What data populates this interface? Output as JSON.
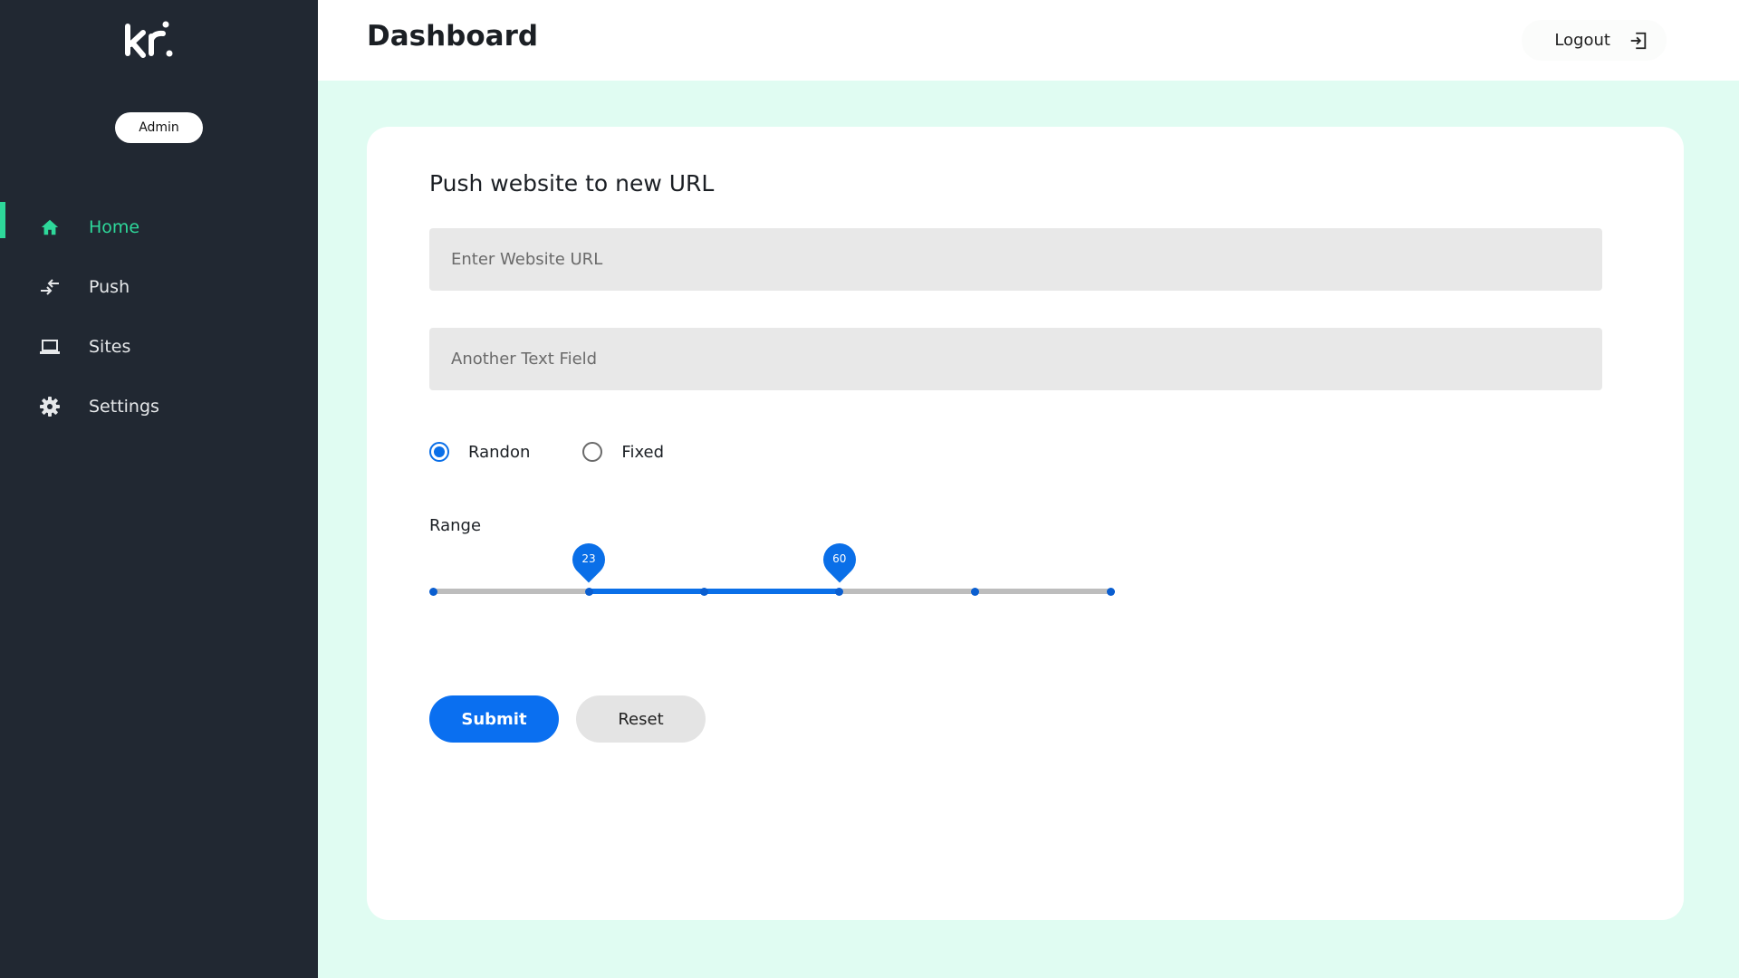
{
  "sidebar": {
    "logo_text": "kr.",
    "role_badge": "Admin",
    "items": [
      {
        "label": "Home",
        "icon": "home-icon",
        "active": true
      },
      {
        "label": "Push",
        "icon": "push-arrows-icon",
        "active": false
      },
      {
        "label": "Sites",
        "icon": "laptop-icon",
        "active": false
      },
      {
        "label": "Settings",
        "icon": "gear-icon",
        "active": false
      }
    ],
    "active_color": "#2ed89a",
    "background": "#212832"
  },
  "header": {
    "title": "Dashboard",
    "logout_label": "Logout",
    "logout_icon": "logout-icon"
  },
  "form": {
    "title": "Push website to new URL",
    "url_field": {
      "placeholder": "Enter Website URL",
      "value": ""
    },
    "other_field": {
      "placeholder": "Another Text Field",
      "value": ""
    },
    "radio_options": [
      {
        "label": "Randon",
        "checked": true
      },
      {
        "label": "Fixed",
        "checked": false
      }
    ],
    "range_label": "Range",
    "range": {
      "min": 0,
      "max": 100,
      "low": 23,
      "high": 60,
      "low_label": "23",
      "high_label": "60",
      "marks": [
        0,
        23,
        40,
        60,
        80,
        100
      ]
    },
    "submit_label": "Submit",
    "reset_label": "Reset"
  },
  "colors": {
    "accent": "#0a6ff0",
    "page_background": "#e0fcf2"
  }
}
